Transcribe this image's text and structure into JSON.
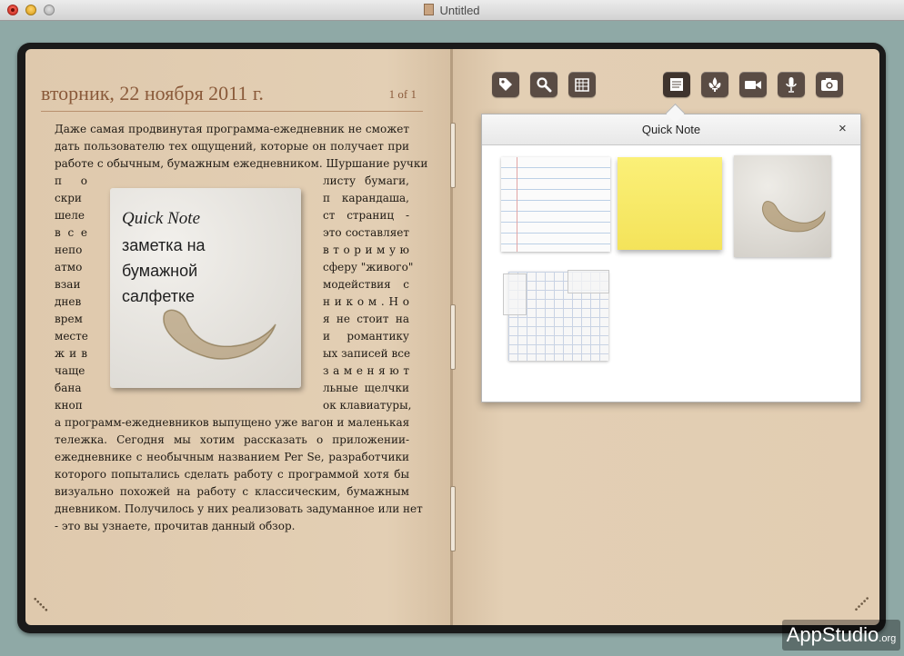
{
  "window": {
    "title": "Untitled"
  },
  "journal": {
    "date": "вторник, 22 ноября 2011 г.",
    "page_indicator": "1 of 1",
    "lines": [
      "Даже самая продвинутая программа-ежедневник не сможет",
      "дать пользователю тех ощущений, которые он получает при",
      "работе с обычным, бумажным ежедневником. Шуршание ручки"
    ],
    "wrap_left": [
      "п о",
      "скри",
      "шеле",
      "в с е",
      "непо",
      "атмо",
      "взаи",
      "днев",
      "врем",
      "месте",
      "ж и в",
      "чаще",
      "бана",
      "кноп"
    ],
    "wrap_right": [
      "листу бумаги,",
      "п карандаша,",
      "ст страниц -",
      "это составляет",
      "в т о р и м у ю",
      "сферу \"живого\"",
      "модействия с",
      "н и к о м .  Н о",
      "я не стоит на",
      "и романтику",
      "ых записей все",
      "з а м е н я ю т",
      "льные щелчки",
      "ок клавиатуры,"
    ],
    "lines_after": [
      "а программ-ежедневников выпущено уже вагон и маленькая",
      "тележка. Сегодня мы хотим рассказать о приложении-",
      "ежедневнике с необычным названием Per Se, разработчики",
      "которого попытались сделать работу с программой хотя бы",
      "визуально похожей на работу с классическим, бумажным",
      "дневником. Получилось у них реализовать задуманное или нет",
      "- это вы узнаете, прочитав данный обзор."
    ]
  },
  "napkin_note": {
    "title": "Quick Note",
    "lines": [
      "заметка на",
      "бумажной",
      "салфетке"
    ]
  },
  "toolbar": {
    "icons": [
      "tag-icon",
      "search-icon",
      "calendar-icon",
      "note-icon",
      "fleur-de-lis-icon",
      "video-camera-icon",
      "microphone-icon",
      "camera-icon"
    ]
  },
  "quick_note_popover": {
    "title": "Quick Note",
    "close_label": "×",
    "paper_options": [
      "lined-paper",
      "sticky-note",
      "napkin",
      "grid-paper"
    ]
  },
  "watermark": {
    "brand": "AppStudio",
    "suffix": ".org"
  },
  "colors": {
    "ink": "#8a5a3a",
    "page": "#e2cdb2",
    "background": "#8fa9a6",
    "sticky": "#f4e35a"
  }
}
